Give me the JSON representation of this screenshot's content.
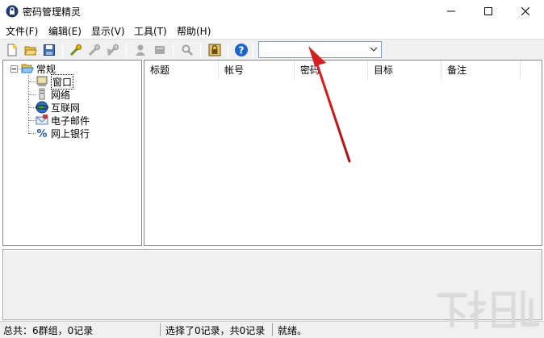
{
  "window": {
    "title": "密码管理精灵",
    "minimize_glyph": "—",
    "maximize_glyph": "☐",
    "close_glyph": "✕"
  },
  "menu": {
    "items": [
      {
        "label": "文件(F)"
      },
      {
        "label": "编辑(E)"
      },
      {
        "label": "显示(V)"
      },
      {
        "label": "工具(T)"
      },
      {
        "label": "帮助(H)"
      }
    ]
  },
  "toolbar": {
    "icons": [
      "new-file-icon",
      "open-folder-icon",
      "save-disk-icon",
      "add-key-icon",
      "edit-key-icon",
      "delete-key-icon",
      "user-icon",
      "card-icon",
      "search-icon",
      "lock-icon",
      "help-icon"
    ],
    "search_combo_value": ""
  },
  "tree": {
    "root": {
      "label": "常规",
      "icon": "folder-open-icon"
    },
    "children": [
      {
        "label": "窗口",
        "icon": "window-app-icon",
        "selected": true
      },
      {
        "label": "网络",
        "icon": "network-icon"
      },
      {
        "label": "互联网",
        "icon": "globe-icon"
      },
      {
        "label": "电子邮件",
        "icon": "email-icon"
      },
      {
        "label": "网上银行",
        "icon": "bank-percent-icon"
      }
    ]
  },
  "list": {
    "columns": [
      "标题",
      "帐号",
      "密码",
      "目标",
      "备注"
    ],
    "rows": []
  },
  "statusbar": {
    "total": "总共：6群组，0记录",
    "selection": "选择了0记录，共0记录",
    "state": "就绪。"
  },
  "watermark": {
    "text": "下载吧"
  },
  "colors": {
    "annotation_arrow": "#d32020",
    "help_icon": "#1e64c8",
    "folder": "#e8c04a"
  }
}
